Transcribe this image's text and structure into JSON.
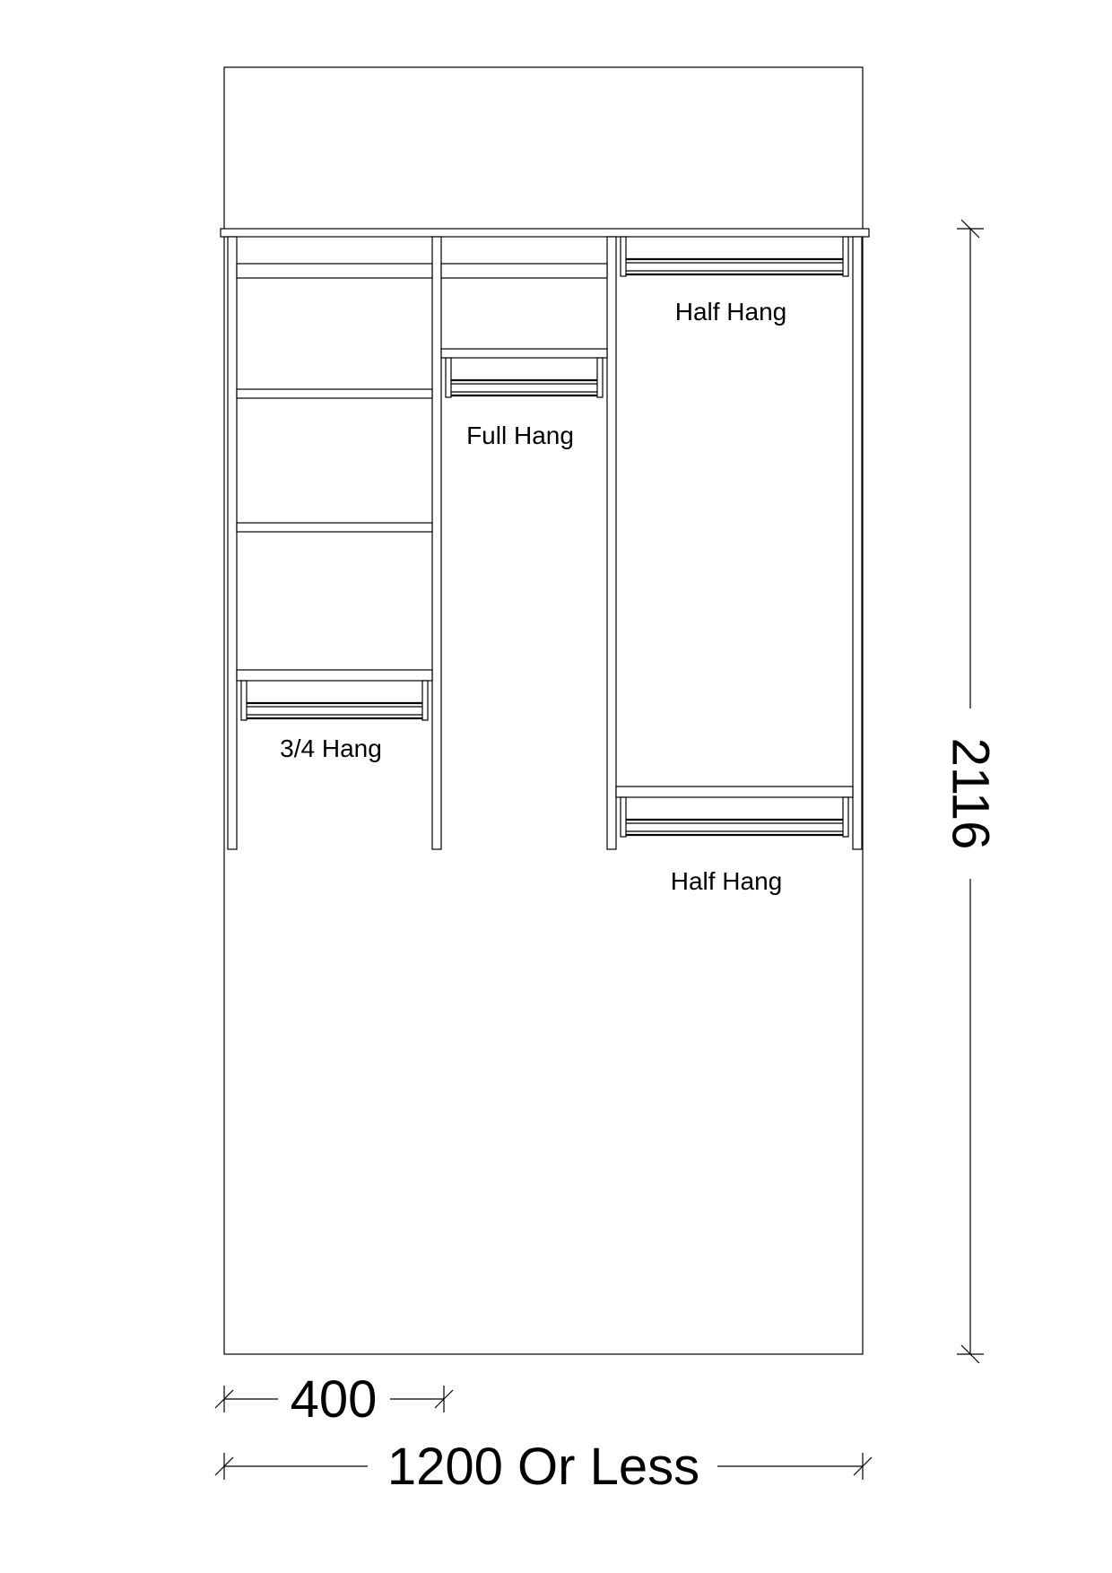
{
  "labels": {
    "half_hang_top": "Half Hang",
    "full_hang": "Full Hang",
    "three_quarter_hang": "3/4 Hang",
    "half_hang_bottom": "Half Hang"
  },
  "dimensions": {
    "height": "2116",
    "section_width": "400",
    "total_width": "1200 Or Less"
  }
}
